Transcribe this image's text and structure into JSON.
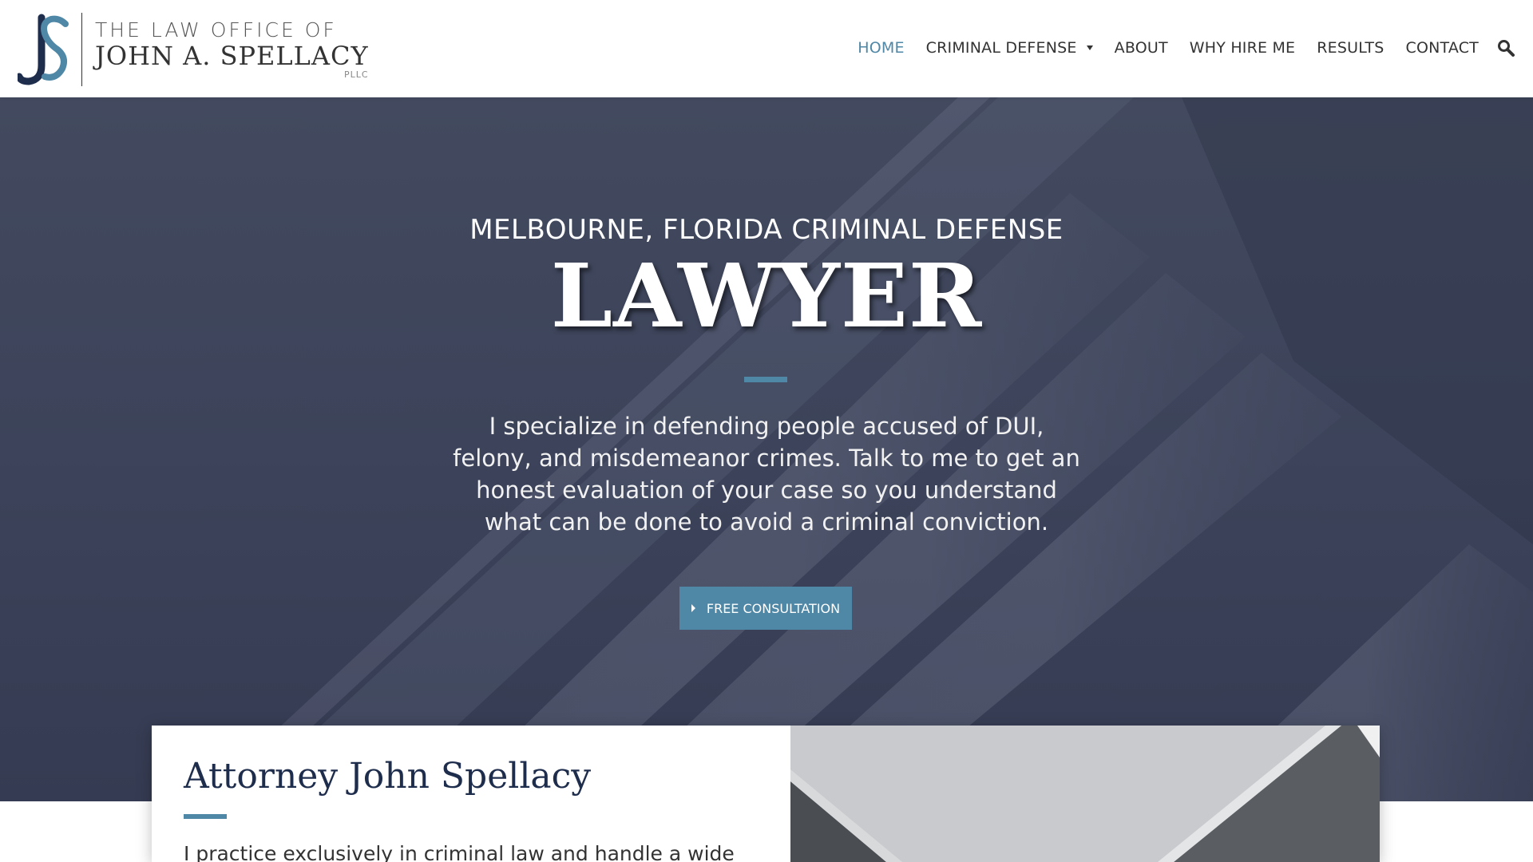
{
  "logo": {
    "line1": "THE LAW OFFICE OF",
    "line2": "JOHN A. SPELLACY",
    "line3": "PLLC",
    "accent_color": "#4f87a6"
  },
  "nav": {
    "items": [
      {
        "label": "HOME",
        "active": true
      },
      {
        "label": "CRIMINAL DEFENSE",
        "has_dropdown": true
      },
      {
        "label": "ABOUT"
      },
      {
        "label": "WHY HIRE ME"
      },
      {
        "label": "RESULTS"
      },
      {
        "label": "CONTACT"
      }
    ],
    "search_icon": "search-icon"
  },
  "hero": {
    "subtitle": "MELBOURNE, FLORIDA CRIMINAL DEFENSE",
    "title": "LAWYER",
    "description": "I specialize in defending people accused of DUI, felony, and misdemeanor crimes. Talk to me to get an honest evaluation of your case so you understand what can be done to avoid a criminal conviction.",
    "cta_label": "FREE CONSULTATION",
    "background_color": "#3c435a"
  },
  "card": {
    "title": "Attorney John Spellacy",
    "text": "I practice exclusively in criminal law and handle a wide"
  },
  "colors": {
    "accent": "#4f87a6",
    "navy": "#1f2d4d",
    "nav_text": "#333333"
  }
}
